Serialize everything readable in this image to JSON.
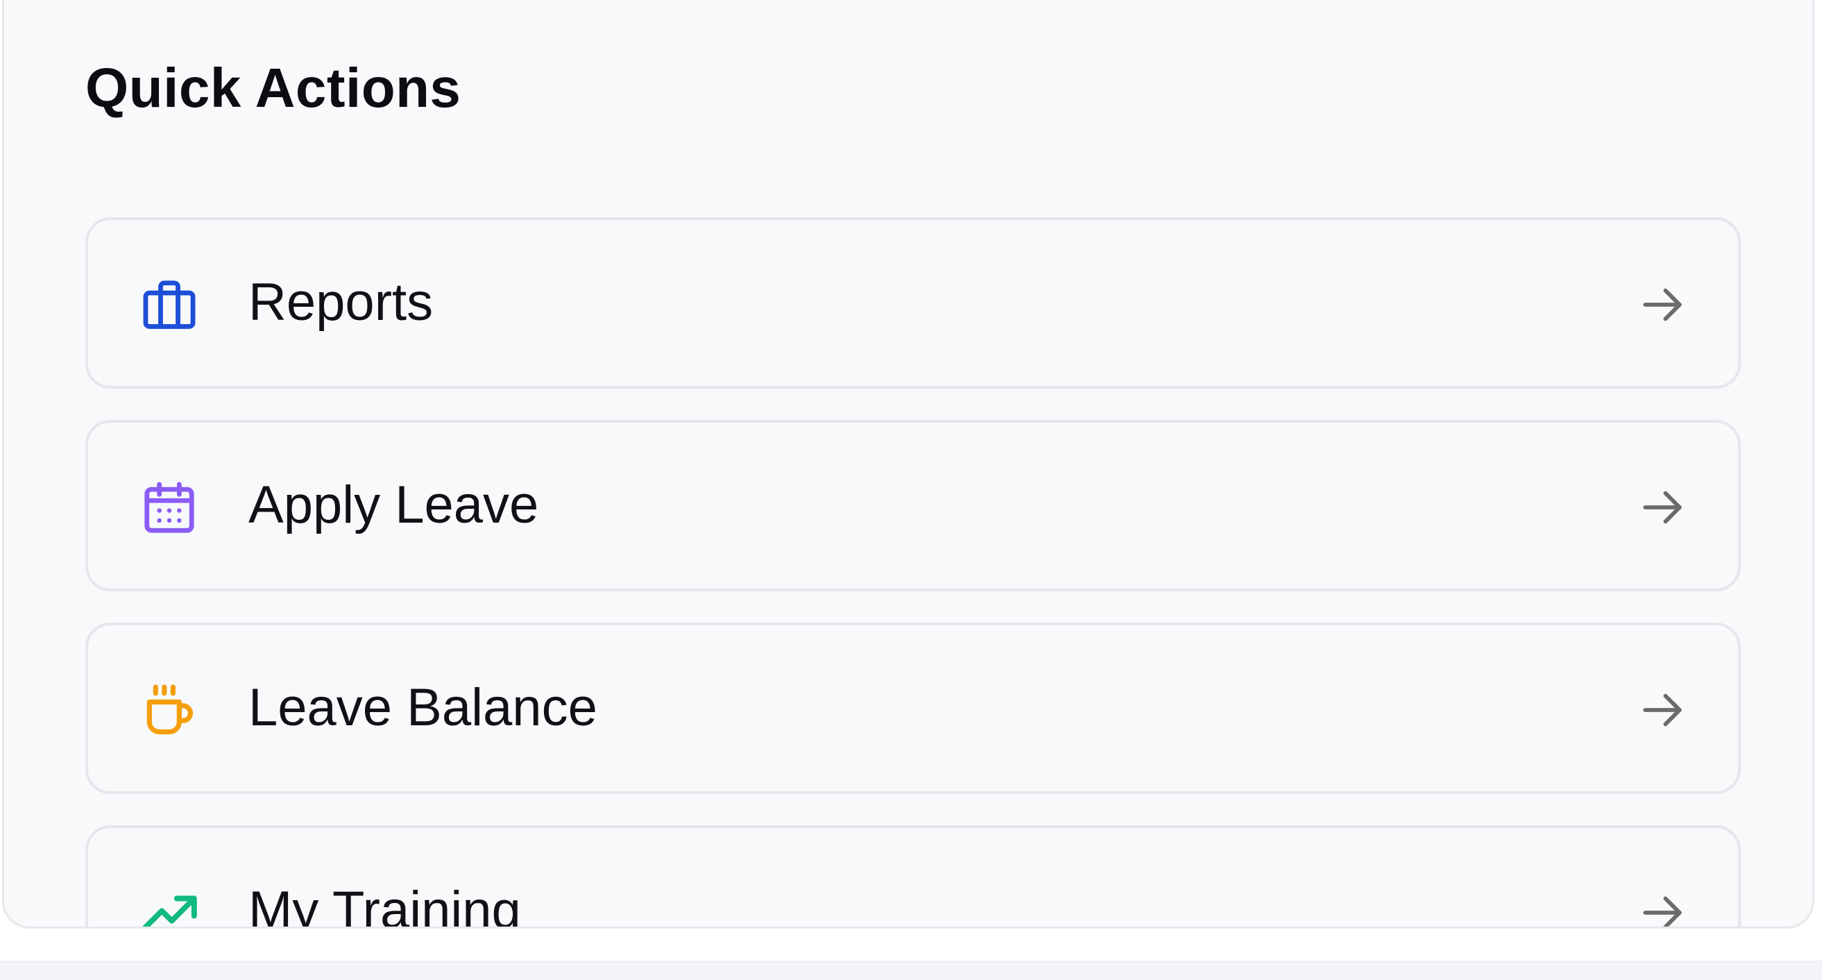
{
  "card": {
    "title": "Quick Actions"
  },
  "actions": [
    {
      "label": "Reports",
      "icon": "briefcase-icon",
      "color": "#1d4ed8"
    },
    {
      "label": "Apply Leave",
      "icon": "calendar-icon",
      "color": "#8b5cf6"
    },
    {
      "label": "Leave Balance",
      "icon": "coffee-icon",
      "color": "#f59e0b"
    },
    {
      "label": "My Training",
      "icon": "trending-up-icon",
      "color": "#10b981"
    }
  ],
  "colors": {
    "arrow": "#6b6b6b",
    "card_background": "#f8f9fb",
    "border": "#e5e7eb"
  }
}
